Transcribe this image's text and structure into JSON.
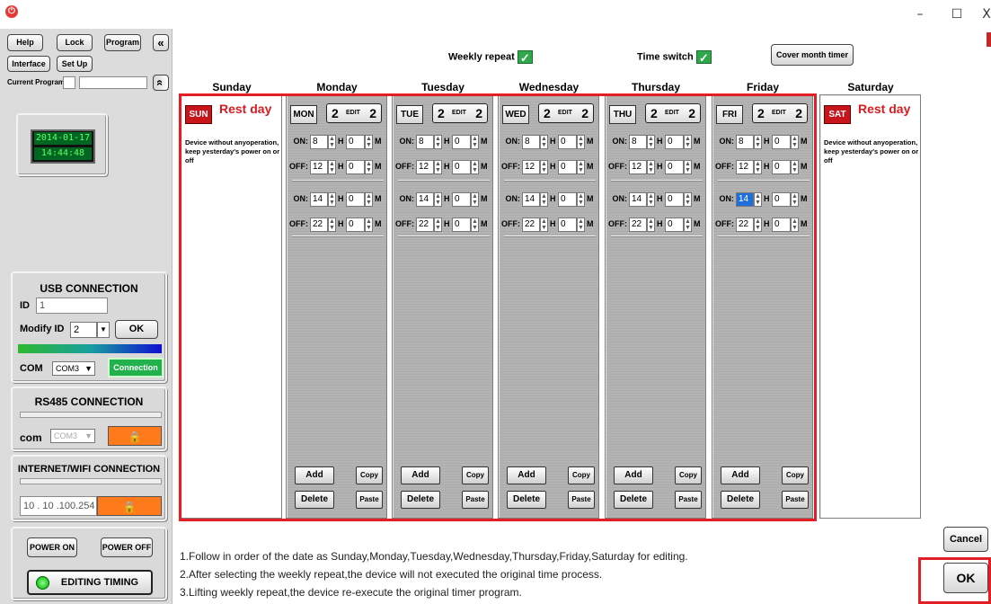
{
  "window": {
    "min": "–",
    "max": "☐",
    "close": "X"
  },
  "sidebar": {
    "buttons": {
      "help": "Help",
      "lock": "Lock",
      "program": "Program",
      "interface": "Interface",
      "setup": "Set Up",
      "collapse": "«",
      "expand": "«"
    },
    "current_program_label": "Current Program",
    "date": "2014-01-17",
    "time": "14:44:48",
    "usb": {
      "title": "USB CONNECTION",
      "id_label": "ID",
      "id_value": "1",
      "modify_label": "Modify ID",
      "modify_value": "2",
      "ok": "OK",
      "com_label": "COM",
      "com_value": "COM3",
      "connection": "Connection"
    },
    "rs485": {
      "title": "RS485 CONNECTION",
      "com_label": "com",
      "com_value": "COM3"
    },
    "wifi": {
      "title": "INTERNET/WIFI CONNECTION",
      "ip": "10 . 10 .100.254"
    },
    "power_on": "POWER ON",
    "power_off": "POWER OFF",
    "editing_timing": "EDITING TIMING"
  },
  "top": {
    "weekly_repeat": "Weekly repeat",
    "time_switch": "Time switch",
    "cover_month": "Cover month timer",
    "check": "✓"
  },
  "days": [
    {
      "name": "Sunday",
      "abbr": "SUN",
      "rest": true,
      "rest_label": "Rest day",
      "note": "Device without anyoperation, keep yesterday's power on or off"
    },
    {
      "name": "Monday",
      "abbr": "MON",
      "count": "2",
      "edit": "EDIT"
    },
    {
      "name": "Tuesday",
      "abbr": "TUE",
      "count": "2",
      "edit": "EDIT"
    },
    {
      "name": "Wednesday",
      "abbr": "WED",
      "count": "2",
      "edit": "EDIT"
    },
    {
      "name": "Thursday",
      "abbr": "THU",
      "count": "2",
      "edit": "EDIT"
    },
    {
      "name": "Friday",
      "abbr": "FRI",
      "count": "2",
      "edit": "EDIT"
    },
    {
      "name": "Saturday",
      "abbr": "SAT",
      "rest": true,
      "rest_label": "Rest day",
      "note": "Device without anyoperation, keep yesterday's power on or off"
    }
  ],
  "timers": [
    {
      "label": "ON:",
      "h": "8",
      "m": "0"
    },
    {
      "label": "OFF:",
      "h": "12",
      "m": "0"
    },
    {
      "label": "ON:",
      "h": "14",
      "m": "0"
    },
    {
      "label": "OFF:",
      "h": "22",
      "m": "0"
    }
  ],
  "h_unit": "H",
  "m_unit": "M",
  "actions": {
    "add": "Add",
    "copy": "Copy",
    "delete": "Delete",
    "paste": "Paste"
  },
  "notes": [
    "1.Follow in order of the date as Sunday,Monday,Tuesday,Wednesday,Thursday,Friday,Saturday for editing.",
    "2.After selecting the weekly repeat,the device will not executed the original time process.",
    "3.Lifting weekly repeat,the device re-execute the original timer program."
  ],
  "cancel": "Cancel",
  "ok": "OK",
  "colors": {
    "accent_red": "#e31e24",
    "green": "#2ea84a",
    "orange": "#ff7a1a"
  }
}
